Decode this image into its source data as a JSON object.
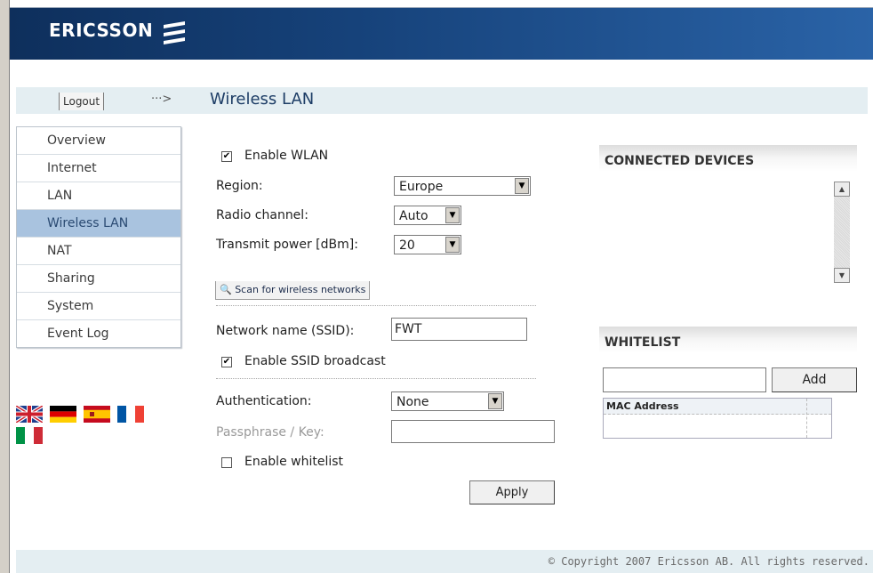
{
  "brand": {
    "logo_text": "ERICSSON"
  },
  "header": {
    "logout_label": "Logout",
    "arrow_glyph": "···>",
    "title": "Wireless LAN"
  },
  "sidebar": {
    "items": [
      {
        "label": "Overview",
        "active": false
      },
      {
        "label": "Internet",
        "active": false
      },
      {
        "label": "LAN",
        "active": false
      },
      {
        "label": "Wireless LAN",
        "active": true
      },
      {
        "label": "NAT",
        "active": false
      },
      {
        "label": "Sharing",
        "active": false
      },
      {
        "label": "System",
        "active": false
      },
      {
        "label": "Event Log",
        "active": false
      }
    ],
    "flags": [
      "uk-flag-icon",
      "germany-flag-icon",
      "spain-flag-icon",
      "france-flag-icon",
      "italy-flag-icon"
    ]
  },
  "form": {
    "enable_wlan_label": "Enable WLAN",
    "enable_wlan_checked": true,
    "region_label": "Region:",
    "region_value": "Europe",
    "channel_label": "Radio channel:",
    "channel_value": "Auto",
    "power_label": "Transmit power [dBm]:",
    "power_value": "20",
    "scan_label": "Scan for wireless networks",
    "ssid_label": "Network name (SSID):",
    "ssid_value": "FWT",
    "ssid_broadcast_label": "Enable SSID broadcast",
    "ssid_broadcast_checked": true,
    "auth_label": "Authentication:",
    "auth_value": "None",
    "passphrase_label": "Passphrase / Key:",
    "passphrase_value": "",
    "whitelist_label": "Enable whitelist",
    "whitelist_checked": false,
    "apply_label": "Apply"
  },
  "connected": {
    "title": "CONNECTED DEVICES"
  },
  "whitelist": {
    "title": "WHITELIST",
    "add_label": "Add",
    "mac_input_value": "",
    "column_header": "MAC Address"
  },
  "footer": {
    "copyright": "© Copyright 2007 Ericsson AB. All rights reserved."
  },
  "colors": {
    "banner": "#16427a",
    "nav_active": "#a9c3df",
    "title": "#1d3d66",
    "crumb_bar": "#e4eef2"
  }
}
